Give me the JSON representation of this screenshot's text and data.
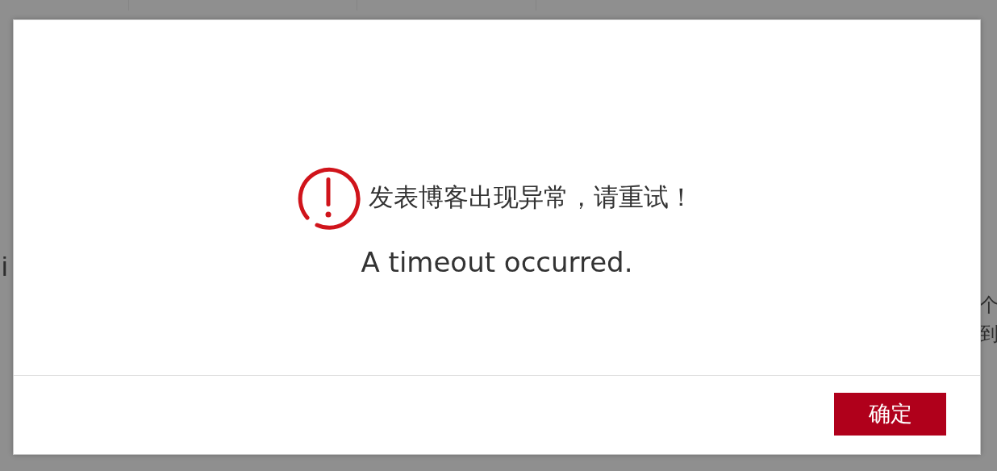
{
  "background": {
    "left_text": "i",
    "right_texts": [
      "个",
      "到"
    ]
  },
  "dialog": {
    "message": "发表博客出现异常，请重试！",
    "detail": "A timeout occurred.",
    "buttons": [
      {
        "label": "确定",
        "kind": "primary"
      }
    ]
  }
}
